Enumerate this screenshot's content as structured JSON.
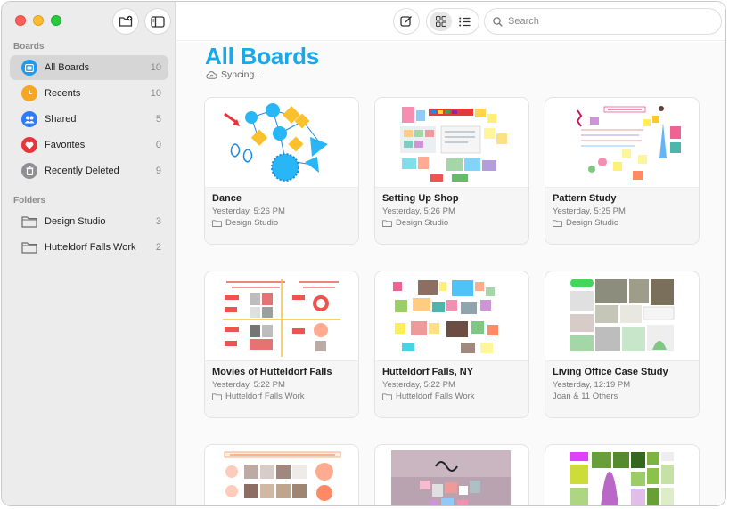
{
  "sidebar": {
    "boards_header": "Boards",
    "folders_header": "Folders",
    "boards": [
      {
        "label": "All Boards",
        "count": "10",
        "icon": "boards-icon",
        "color": "#1d9bf0"
      },
      {
        "label": "Recents",
        "count": "10",
        "icon": "clock-icon",
        "color": "#f5a623"
      },
      {
        "label": "Shared",
        "count": "5",
        "icon": "people-icon",
        "color": "#2d7cf6"
      },
      {
        "label": "Favorites",
        "count": "0",
        "icon": "heart-icon",
        "color": "#e8353b"
      },
      {
        "label": "Recently Deleted",
        "count": "9",
        "icon": "trash-icon",
        "color": "#8e8e93"
      }
    ],
    "folders": [
      {
        "label": "Design Studio",
        "count": "3"
      },
      {
        "label": "Hutteldorf Falls Work",
        "count": "2"
      }
    ]
  },
  "toolbar": {
    "search_placeholder": "Search"
  },
  "main": {
    "title": "All Boards",
    "sync_status": "Syncing...",
    "accent": "#19a9ea",
    "boards": [
      {
        "name": "Dance",
        "date": "Yesterday, 5:26 PM",
        "location": "Design Studio",
        "location_icon": "folder-icon"
      },
      {
        "name": "Setting Up Shop",
        "date": "Yesterday, 5:26 PM",
        "location": "Design Studio",
        "location_icon": "folder-icon"
      },
      {
        "name": "Pattern Study",
        "date": "Yesterday, 5:25 PM",
        "location": "Design Studio",
        "location_icon": "folder-icon"
      },
      {
        "name": "Movies of Hutteldorf Falls",
        "date": "Yesterday, 5:22 PM",
        "location": "Hutteldorf Falls Work",
        "location_icon": "folder-icon"
      },
      {
        "name": "Hutteldorf Falls, NY",
        "date": "Yesterday, 5:22 PM",
        "location": "Hutteldorf Falls Work",
        "location_icon": "folder-icon"
      },
      {
        "name": "Living Office Case Study",
        "date": "Yesterday, 12:19 PM",
        "location": "Joan & 11 Others",
        "location_icon": "none"
      }
    ]
  }
}
